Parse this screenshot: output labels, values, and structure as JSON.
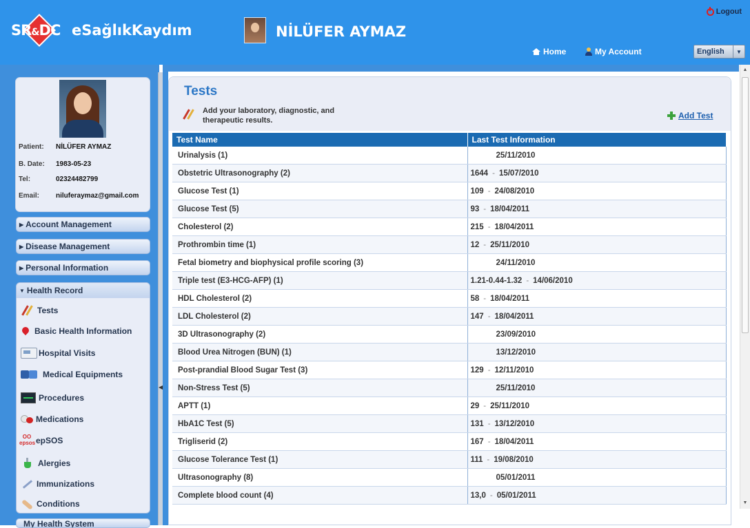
{
  "header": {
    "logo_text": "SR",
    "logo_amp": "&",
    "logo_text2": "DC",
    "app_title": "eSağlıkKaydım",
    "user_name": "NİLÜFER AYMAZ",
    "logout_label": "Logout",
    "home_label": "Home",
    "account_label": "My Account",
    "language": "English"
  },
  "profile": {
    "patient_label": "Patient:",
    "patient_value": "NİLÜFER AYMAZ",
    "bdate_label": "B. Date:",
    "bdate_value": "1983-05-23",
    "tel_label": "Tel:",
    "tel_value": "02324482799",
    "email_label": "Email:",
    "email_value": "niluferaymaz@gmail.com"
  },
  "sidebar": {
    "account_management": "Account Management",
    "disease_management": "Disease Management",
    "personal_information": "Personal Information",
    "health_record": "Health Record",
    "items": [
      {
        "label": "Tests",
        "icon": "tests-icon"
      },
      {
        "label": "Basic Health Information",
        "icon": "heart-icon"
      },
      {
        "label": "Hospital Visits",
        "icon": "ambulance-icon"
      },
      {
        "label": "Medical Equipments",
        "icon": "equipment-icon"
      },
      {
        "label": "Procedures",
        "icon": "monitor-icon"
      },
      {
        "label": "Medications",
        "icon": "pill-icon"
      },
      {
        "label": "epSOS",
        "icon": "epsos-icon"
      },
      {
        "label": "Alergies",
        "icon": "flask-icon"
      },
      {
        "label": "Immunizations",
        "icon": "syringe-icon"
      },
      {
        "label": "Conditions",
        "icon": "bandage-icon"
      }
    ],
    "cut_item": "My Health System"
  },
  "main": {
    "title": "Tests",
    "description": "Add your laboratory, diagnostic, and therapeutic results.",
    "add_label": "Add Test",
    "columns": [
      "Test Name",
      "Last Test Information"
    ],
    "rows": [
      {
        "name": "Urinalysis (1)",
        "value": "",
        "date": "25/11/2010"
      },
      {
        "name": "Obstetric Ultrasonography (2)",
        "value": "1644",
        "date": "15/07/2010"
      },
      {
        "name": "Glucose Test (1)",
        "value": "109",
        "date": "24/08/2010"
      },
      {
        "name": "Glucose  Test (5)",
        "value": "93",
        "date": "18/04/2011"
      },
      {
        "name": "Cholesterol (2)",
        "value": "215",
        "date": "18/04/2011"
      },
      {
        "name": "Prothrombin time (1)",
        "value": "12",
        "date": "25/11/2010"
      },
      {
        "name": "Fetal biometry and biophysical profile scoring (3)",
        "value": "",
        "date": "24/11/2010"
      },
      {
        "name": "Triple test (E3-HCG-AFP) (1)",
        "value": "1.21-0.44-1.32",
        "date": "14/06/2010"
      },
      {
        "name": "HDL Cholesterol (2)",
        "value": "58",
        "date": "18/04/2011"
      },
      {
        "name": "LDL Cholesterol (2)",
        "value": "147",
        "date": "18/04/2011"
      },
      {
        "name": "3D Ultrasonography (2)",
        "value": "",
        "date": "23/09/2010"
      },
      {
        "name": "Blood Urea Nitrogen (BUN) (1)",
        "value": "",
        "date": "13/12/2010"
      },
      {
        "name": "Post-prandial Blood Sugar Test (3)",
        "value": "129",
        "date": "12/11/2010"
      },
      {
        "name": "Non-Stress Test (5)",
        "value": "",
        "date": "25/11/2010"
      },
      {
        "name": "APTT (1)",
        "value": "29",
        "date": "25/11/2010"
      },
      {
        "name": "HbA1C Test  (5)",
        "value": "131",
        "date": "13/12/2010"
      },
      {
        "name": "Trigliserid (2)",
        "value": "167",
        "date": "18/04/2011"
      },
      {
        "name": "Glucose Tolerance Test (1)",
        "value": "111",
        "date": "19/08/2010"
      },
      {
        "name": "Ultrasonography (8)",
        "value": "",
        "date": "05/01/2011"
      },
      {
        "name": "Complete blood count (4)",
        "value": "13,0",
        "date": "05/01/2011"
      }
    ]
  },
  "colors": {
    "header_blue": "#2f93ea",
    "table_header": "#1b6bb2",
    "title_blue": "#2c77c6",
    "link_blue": "#1d5fae"
  }
}
